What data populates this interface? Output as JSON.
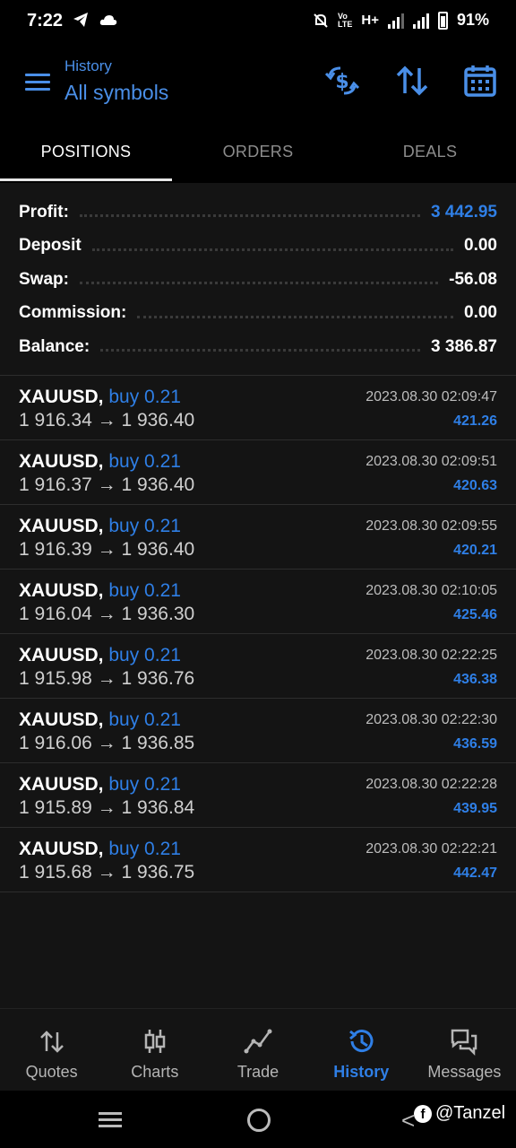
{
  "status_bar": {
    "time": "7:22",
    "network": "H+",
    "battery": "91%"
  },
  "header": {
    "subtitle": "History",
    "title": "All symbols"
  },
  "tabs": [
    {
      "label": "POSITIONS",
      "active": true
    },
    {
      "label": "ORDERS",
      "active": false
    },
    {
      "label": "DEALS",
      "active": false
    }
  ],
  "summary": {
    "profit": {
      "label": "Profit:",
      "value": "3 442.95"
    },
    "deposit": {
      "label": "Deposit",
      "value": "0.00"
    },
    "swap": {
      "label": "Swap:",
      "value": "-56.08"
    },
    "commission": {
      "label": "Commission:",
      "value": "0.00"
    },
    "balance": {
      "label": "Balance:",
      "value": "3 386.87"
    }
  },
  "deals": [
    {
      "symbol": "XAUUSD,",
      "side": "buy 0.21",
      "open": "1 916.34",
      "close": "1 936.40",
      "time": "2023.08.30 02:09:47",
      "profit": "421.26"
    },
    {
      "symbol": "XAUUSD,",
      "side": "buy 0.21",
      "open": "1 916.37",
      "close": "1 936.40",
      "time": "2023.08.30 02:09:51",
      "profit": "420.63"
    },
    {
      "symbol": "XAUUSD,",
      "side": "buy 0.21",
      "open": "1 916.39",
      "close": "1 936.40",
      "time": "2023.08.30 02:09:55",
      "profit": "420.21"
    },
    {
      "symbol": "XAUUSD,",
      "side": "buy 0.21",
      "open": "1 916.04",
      "close": "1 936.30",
      "time": "2023.08.30 02:10:05",
      "profit": "425.46"
    },
    {
      "symbol": "XAUUSD,",
      "side": "buy 0.21",
      "open": "1 915.98",
      "close": "1 936.76",
      "time": "2023.08.30 02:22:25",
      "profit": "436.38"
    },
    {
      "symbol": "XAUUSD,",
      "side": "buy 0.21",
      "open": "1 916.06",
      "close": "1 936.85",
      "time": "2023.08.30 02:22:30",
      "profit": "436.59"
    },
    {
      "symbol": "XAUUSD,",
      "side": "buy 0.21",
      "open": "1 915.89",
      "close": "1 936.84",
      "time": "2023.08.30 02:22:28",
      "profit": "439.95"
    },
    {
      "symbol": "XAUUSD,",
      "side": "buy 0.21",
      "open": "1 915.68",
      "close": "1 936.75",
      "time": "2023.08.30 02:22:21",
      "profit": "442.47"
    }
  ],
  "bottom_nav": [
    {
      "label": "Quotes",
      "icon": "quotes-icon",
      "active": false
    },
    {
      "label": "Charts",
      "icon": "candlestick-icon",
      "active": false
    },
    {
      "label": "Trade",
      "icon": "trade-icon",
      "active": false
    },
    {
      "label": "History",
      "icon": "history-icon",
      "active": true
    },
    {
      "label": "Messages",
      "icon": "messages-icon",
      "active": false
    }
  ],
  "watermark": "@Tanzel",
  "colors": {
    "accent": "#2f7fe6",
    "background": "#000000",
    "panel": "#141414"
  }
}
